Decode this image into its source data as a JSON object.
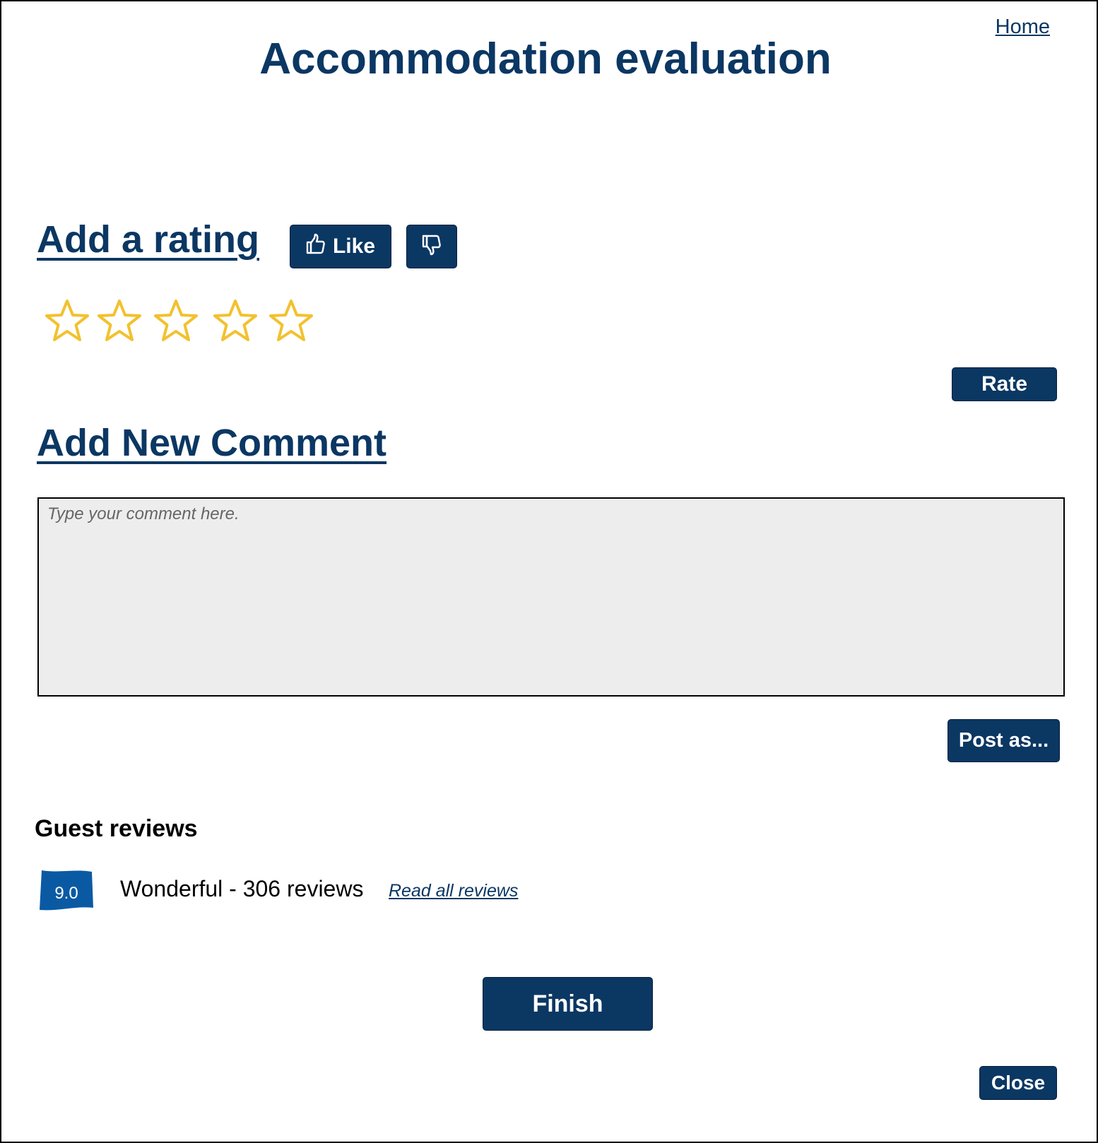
{
  "header": {
    "home_link": "Home",
    "title": "Accommodation evaluation"
  },
  "rating": {
    "heading": "Add a rating",
    "like_label": "Like",
    "like_icon": "thumbs-up-icon",
    "dislike_icon": "thumbs-down-icon",
    "stars": {
      "count": 5,
      "selected": 0,
      "color": "#f2c12e"
    },
    "rate_label": "Rate"
  },
  "comment": {
    "heading": "Add New Comment",
    "placeholder": "Type your comment here.",
    "value": "",
    "post_label": "Post as..."
  },
  "reviews": {
    "heading": "Guest reviews",
    "score": "9.0",
    "summary": "Wonderful - 306 reviews",
    "read_all_label": "Read all reviews",
    "badge_color": "#0a5aa3"
  },
  "footer": {
    "finish_label": "Finish",
    "close_label": "Close"
  },
  "colors": {
    "primary": "#0b3763",
    "star": "#f2c12e",
    "textarea_bg": "#ededed"
  }
}
